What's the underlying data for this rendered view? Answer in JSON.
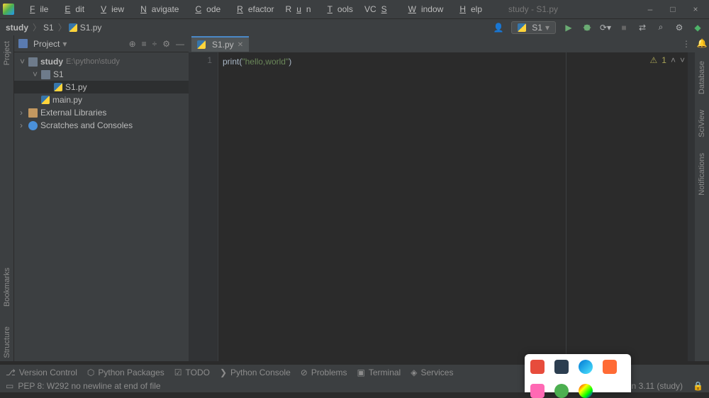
{
  "window": {
    "title_hint": "study - S1.py",
    "minimize": "–",
    "maximize": "□",
    "close": "×"
  },
  "menu": {
    "file": "File",
    "edit": "Edit",
    "view": "View",
    "navigate": "Navigate",
    "code": "Code",
    "refactor": "Refactor",
    "run": "Run",
    "tools": "Tools",
    "vcs": "VCS",
    "window": "Window",
    "help": "Help"
  },
  "breadcrumb": {
    "project": "study",
    "folder": "S1",
    "file": "S1.py"
  },
  "run_config": {
    "label": "S1",
    "dropdown": "▾"
  },
  "project_panel": {
    "title": "Project",
    "root": "study",
    "root_path": "E:\\python\\study",
    "folder": "S1",
    "file1": "S1.py",
    "file2": "main.py",
    "ext_libs": "External Libraries",
    "scratches": "Scratches and Consoles"
  },
  "editor": {
    "tab": "S1.py",
    "line_no": "1",
    "code_fn": "print",
    "code_open": "(",
    "code_str": "\"hello,world\"",
    "code_close": ")",
    "warn_count": "1"
  },
  "left_rail": {
    "project": "Project",
    "bookmarks": "Bookmarks",
    "structure": "Structure"
  },
  "right_rail": {
    "database": "Database",
    "sciview": "SciView",
    "notifications": "Notifications"
  },
  "bottom_tools": {
    "vcs": "Version Control",
    "packages": "Python Packages",
    "todo": "TODO",
    "console": "Python Console",
    "problems": "Problems",
    "terminal": "Terminal",
    "services": "Services"
  },
  "status": {
    "msg": "PEP 8: W292 no newline at end of file",
    "interpreter": "Python 3.11 (study)"
  },
  "icons": {
    "user": "👤",
    "find": "⌕",
    "translate": "⇄",
    "gear": "⚙",
    "more": "⋮"
  }
}
